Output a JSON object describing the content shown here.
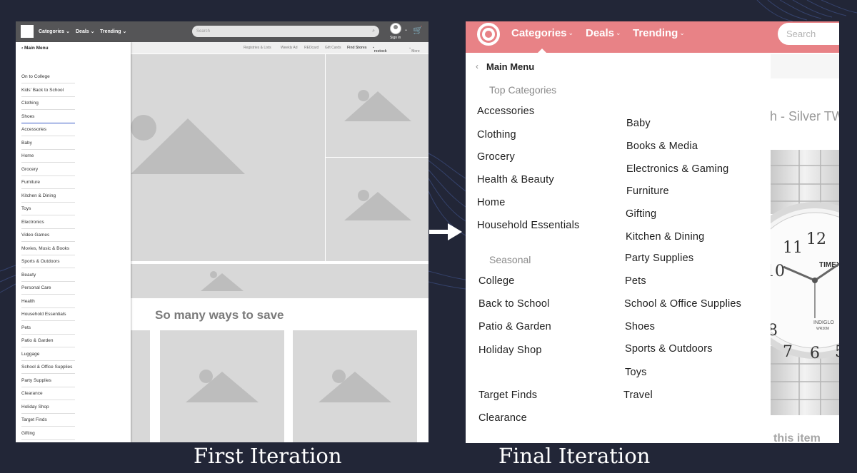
{
  "captions": {
    "first": "First Iteration",
    "final": "Final Iteration"
  },
  "first_iteration": {
    "nav": {
      "categories": "Categories",
      "deals": "Deals",
      "trending": "Trending"
    },
    "search_placeholder": "Search",
    "sign_in": "Sign in",
    "sub_links": [
      "Registries & Lists",
      "Weekly Ad",
      "REDcard",
      "Gift Cards",
      "Find Stores",
      "restock",
      "More"
    ],
    "menu_title": "Main Menu",
    "menu_items": [
      "On to College",
      "Kids' Back to School",
      "Clothing",
      "Shoes",
      "Accessories",
      "Baby",
      "Home",
      "Grocery",
      "Furniture",
      "Kitchen & Dining",
      "Toys",
      "Electronics",
      "Video Games",
      "Movies, Music & Books",
      "Sports & Outdoors",
      "Beauty",
      "Personal Care",
      "Health",
      "Household Essentials",
      "Pets",
      "Patio & Garden",
      "Luggage",
      "School & Office Supplies",
      "Party Supplies",
      "Clearance",
      "Holiday Shop",
      "Target Finds",
      "Gifting"
    ],
    "active_item": "Shoes",
    "save_heading": "So many ways to save"
  },
  "final_iteration": {
    "nav": {
      "categories": "Categories",
      "deals": "Deals",
      "trending": "Trending"
    },
    "search_placeholder": "Search",
    "menu_title": "Main Menu",
    "top_categories_label": "Top Categories",
    "seasonal_label": "Seasonal",
    "col1_top": [
      "Accessories",
      "Clothing",
      "Grocery",
      "Health & Beauty",
      "Home",
      "Household Essentials"
    ],
    "col1_seasonal": [
      "College",
      "Back to School",
      "Patio & Garden",
      "Holiday Shop"
    ],
    "col1_bottom": [
      "Target Finds",
      "Clearance"
    ],
    "col2": [
      "Baby",
      "Books & Media",
      "Electronics & Gaming",
      "Furniture",
      "Gifting",
      "Kitchen & Dining",
      "Party Supplies",
      "Pets",
      "School & Office Supplies",
      "Shoes",
      "Sports & Outdoors",
      "Toys",
      "Travel"
    ],
    "product_title_fragment": "h - Silver TW",
    "this_item_fragment": "this item",
    "watch_brand": "TIMEX",
    "watch_sub": "INDIGLO",
    "watch_sub2": "WR30M",
    "watch_numbers": [
      "12",
      "11",
      "10",
      "8",
      "7",
      "6",
      "5"
    ]
  },
  "colors": {
    "background": "#222637",
    "final_header": "#e88286",
    "wire_header": "#555557",
    "active_underline": "#3a5bc7"
  }
}
